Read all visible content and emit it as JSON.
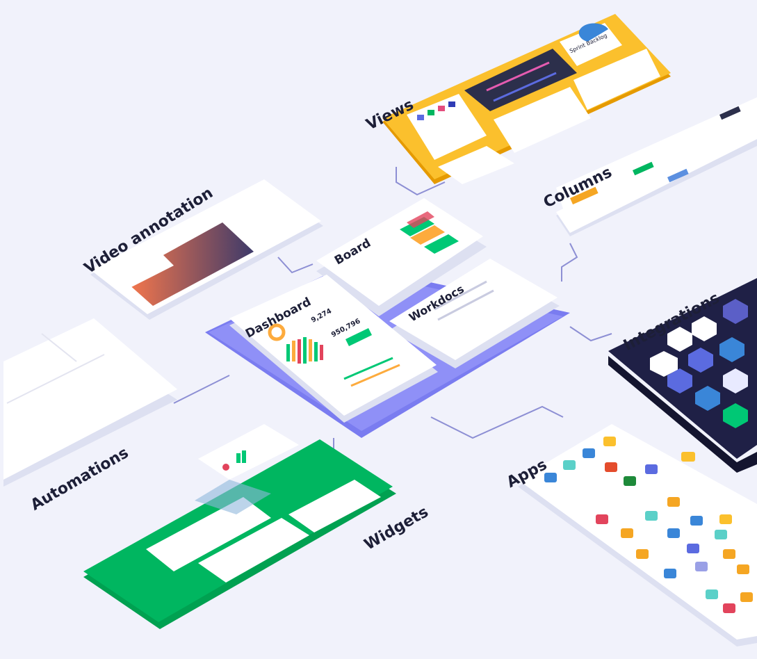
{
  "labels": {
    "views": "Views",
    "columns": "Columns",
    "video_annotation": "Video annotation",
    "board": "Board",
    "workdocs": "Workdocs",
    "dashboard": "Dashboard",
    "integrations": "Integrations",
    "automations": "Automations",
    "apps": "Apps",
    "widgets": "Widgets"
  },
  "dashboard": {
    "stat_1": "9,274",
    "stat_2": "950,796"
  },
  "views_card": {
    "sprint_label": "Sprint Backlog"
  },
  "colors": {
    "background": "#f1f2fb",
    "views_platform": "#fbc02d",
    "dashboard_platform": "#6c6cf5",
    "widgets_platform": "#00b660",
    "integrations_platform": "#1f2046",
    "text": "#1d1f37"
  }
}
